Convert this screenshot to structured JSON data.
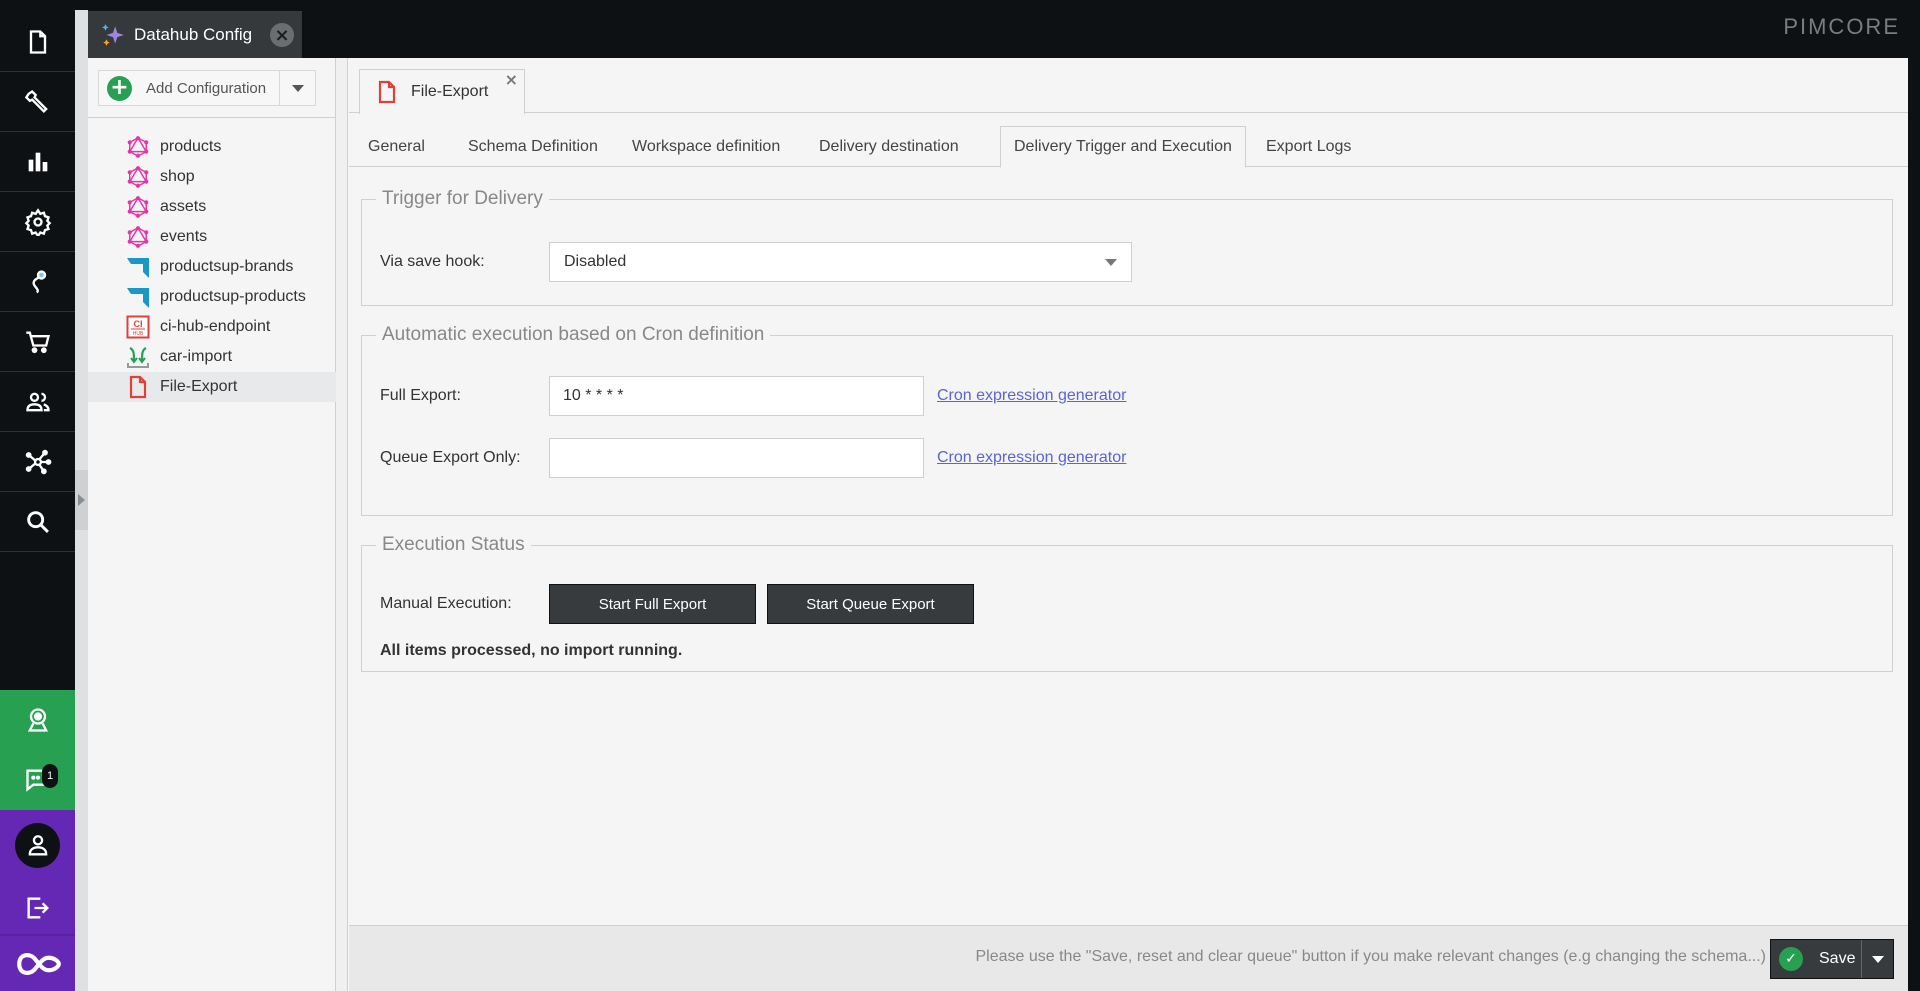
{
  "app": {
    "brand_logo": "PIMCORE",
    "main_tab": {
      "label": "Datahub Config",
      "icon": "sparkles-icon"
    }
  },
  "rail": {
    "items": [
      {
        "name": "documents",
        "icon": "document-icon"
      },
      {
        "name": "tools",
        "icon": "wrench-icon"
      },
      {
        "name": "marketing",
        "icon": "bar-chart-icon"
      },
      {
        "name": "settings",
        "icon": "gear-icon"
      },
      {
        "name": "datahub",
        "icon": "mouse-cable-icon"
      },
      {
        "name": "ecommerce",
        "icon": "cart-icon"
      },
      {
        "name": "users",
        "icon": "users-icon"
      },
      {
        "name": "network",
        "icon": "network-icon"
      },
      {
        "name": "search",
        "icon": "search-icon"
      }
    ],
    "notifications_count": "1"
  },
  "colors": {
    "accent_green": "#27a052",
    "accent_purple": "#6428b4",
    "dark": "#0d1114",
    "button_dark": "#383b3e",
    "link": "#5a63d8"
  },
  "tree": {
    "add_button_label": "Add Configuration",
    "items": [
      {
        "label": "products",
        "icon": "graphql-icon",
        "selected": false
      },
      {
        "label": "shop",
        "icon": "graphql-icon",
        "selected": false
      },
      {
        "label": "assets",
        "icon": "graphql-icon",
        "selected": false
      },
      {
        "label": "events",
        "icon": "graphql-icon",
        "selected": false
      },
      {
        "label": "productsup-brands",
        "icon": "productsup-icon",
        "selected": false
      },
      {
        "label": "productsup-products",
        "icon": "productsup-icon",
        "selected": false
      },
      {
        "label": "ci-hub-endpoint",
        "icon": "cihub-icon",
        "selected": false
      },
      {
        "label": "car-import",
        "icon": "import-icon",
        "selected": false
      },
      {
        "label": "File-Export",
        "icon": "file-export-icon",
        "selected": true
      }
    ]
  },
  "editor": {
    "doc_tab": {
      "label": "File-Export",
      "close": "×"
    },
    "sub_tabs": [
      {
        "label": "General",
        "active": false
      },
      {
        "label": "Schema Definition",
        "active": false
      },
      {
        "label": "Workspace definition",
        "active": false
      },
      {
        "label": "Delivery destination",
        "active": false
      },
      {
        "label": "Delivery Trigger and Execution",
        "active": true
      },
      {
        "label": "Export Logs",
        "active": false
      }
    ],
    "trigger": {
      "legend": "Trigger for Delivery",
      "save_hook_label": "Via save hook:",
      "save_hook_value": "Disabled"
    },
    "cron": {
      "legend": "Automatic execution based on Cron definition",
      "full_export_label": "Full Export:",
      "full_export_value": "10 * * * *",
      "queue_export_label": "Queue Export Only:",
      "queue_export_value": "",
      "generator_link": "Cron expression generator"
    },
    "execution": {
      "legend": "Execution Status",
      "manual_label": "Manual Execution:",
      "start_full_label": "Start Full Export",
      "start_queue_label": "Start Queue Export",
      "status_text": "All items processed, no import running."
    },
    "footer": {
      "hint": "Please use the \"Save, reset and clear queue\" button if you make relevant changes (e.g changing the schema...)",
      "save_label": "Save"
    }
  }
}
